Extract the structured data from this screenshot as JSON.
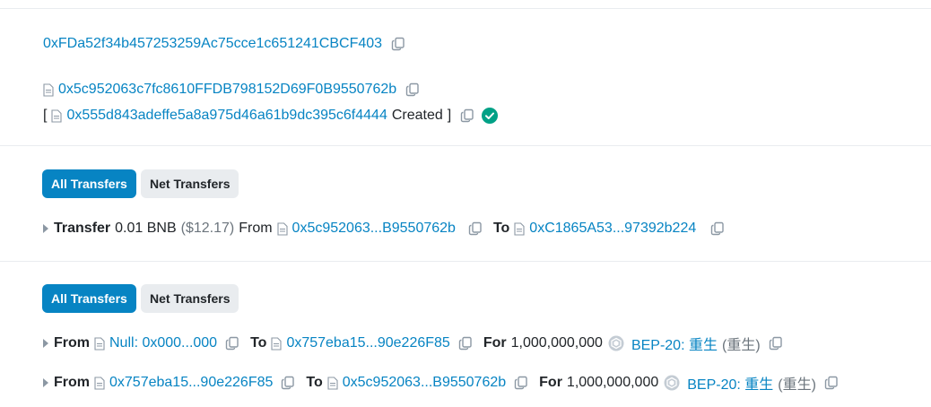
{
  "contract": {
    "address": "0xFDa52f34b457253259Ac75cce1c651241CBCF403",
    "creator": "0x5c952063c7fc8610FFDB798152D69F0B9550762b",
    "created_open": "[",
    "created_address": "0x555d843adeffe5a8a975d46a61b9dc395c6f4444",
    "created_label": "Created",
    "created_close": "]"
  },
  "tabs": {
    "all": "All Transfers",
    "net": "Net Transfers"
  },
  "internal_transfer": {
    "label": "Transfer",
    "amount": "0.01 BNB",
    "usd": "($12.17)",
    "from_label": "From",
    "from": "0x5c952063...B9550762b",
    "to_label": "To",
    "to": "0xC1865A53...97392b224"
  },
  "token_transfers": [
    {
      "from_label": "From",
      "from": "Null: 0x000...000",
      "to_label": "To",
      "to": "0x757eba15...90e226F85",
      "for_label": "For",
      "amount": "1,000,000,000",
      "token": "BEP-20: 重生",
      "symbol": "(重生)"
    },
    {
      "from_label": "From",
      "from": "0x757eba15...90e226F85",
      "to_label": "To",
      "to": "0x5c952063...B9550762b",
      "for_label": "For",
      "amount": "1,000,000,000",
      "token": "BEP-20: 重生",
      "symbol": "(重生)"
    }
  ],
  "colors": {
    "link": "#0784c3",
    "primary": "#0784c3",
    "success": "#00a186"
  }
}
